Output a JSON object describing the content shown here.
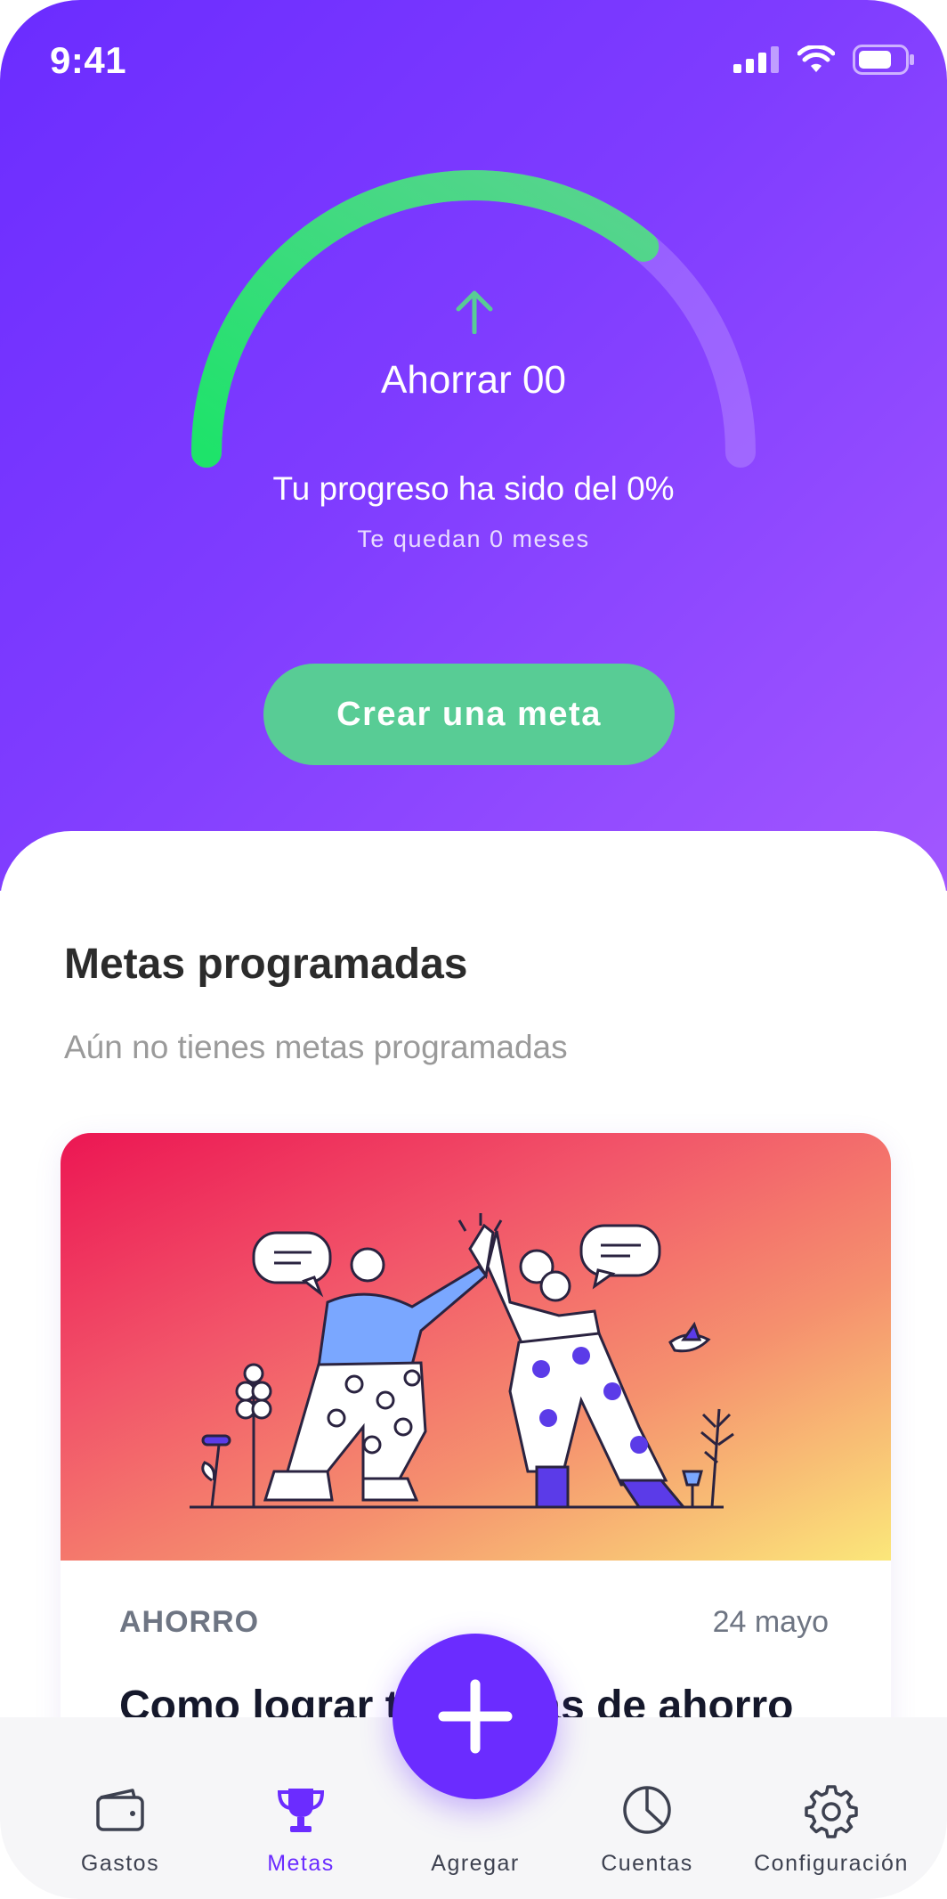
{
  "status_bar": {
    "time": "9:41"
  },
  "goal": {
    "title": "Ahorrar 00",
    "progress_text": "Tu progreso ha sido del 0%",
    "remaining_text": "Te quedan 0 meses",
    "gauge_fill_fraction": 0.72
  },
  "actions": {
    "create_goal_label": "Crear una meta"
  },
  "scheduled": {
    "title": "Metas programadas",
    "empty_text": "Aún no tienes metas programadas"
  },
  "article": {
    "category": "AHORRO",
    "date": "24 mayo",
    "title": "Como lograr tus metas de ahorro para..."
  },
  "nav": {
    "items": [
      {
        "label": "Gastos",
        "icon": "wallet-icon"
      },
      {
        "label": "Metas",
        "icon": "trophy-icon",
        "active": true
      },
      {
        "label": "Agregar",
        "icon": "plus-icon"
      },
      {
        "label": "Cuentas",
        "icon": "pie-chart-icon"
      },
      {
        "label": "Configuración",
        "icon": "gear-icon"
      }
    ]
  },
  "colors": {
    "primary": "#6b2cff",
    "accent_green": "#58cc95",
    "gauge_green": "#1ee36a"
  }
}
